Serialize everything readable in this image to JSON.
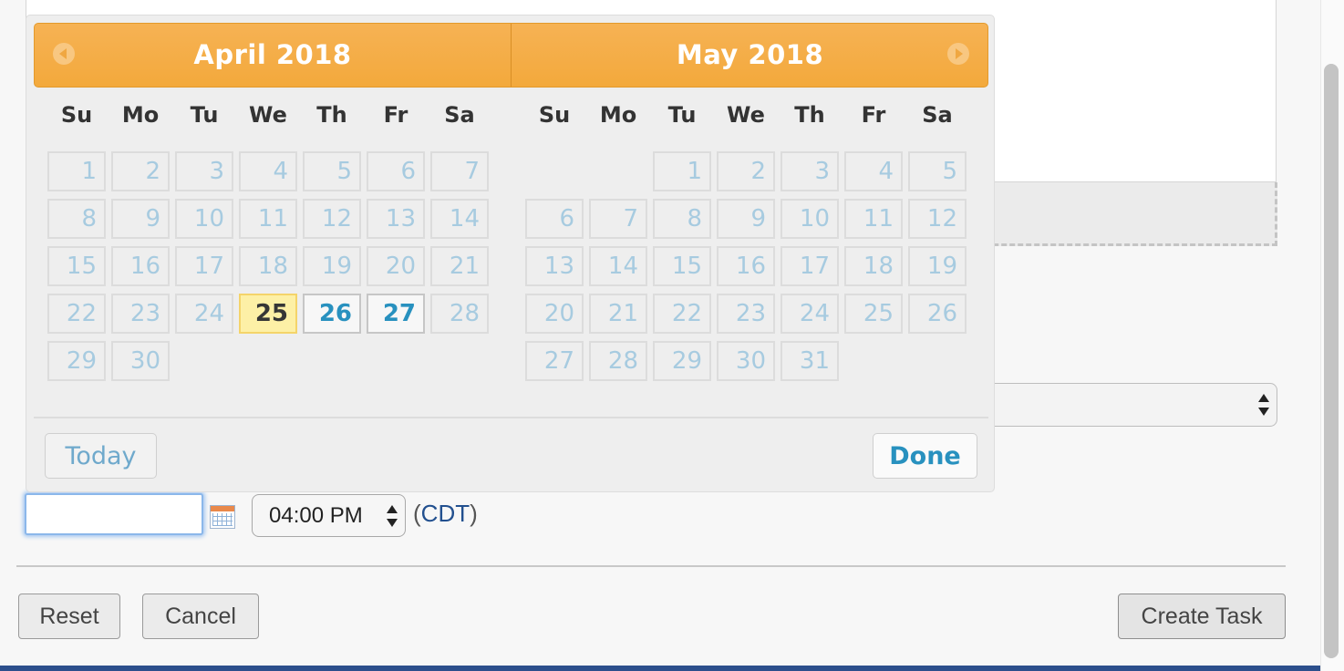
{
  "datepicker": {
    "months": [
      {
        "title": "April 2018",
        "weekdays": [
          "Su",
          "Mo",
          "Tu",
          "We",
          "Th",
          "Fr",
          "Sa"
        ],
        "weeks": [
          [
            "1",
            "2",
            "3",
            "4",
            "5",
            "6",
            "7"
          ],
          [
            "8",
            "9",
            "10",
            "11",
            "12",
            "13",
            "14"
          ],
          [
            "15",
            "16",
            "17",
            "18",
            "19",
            "20",
            "21"
          ],
          [
            "22",
            "23",
            "24",
            "25",
            "26",
            "27",
            "28"
          ],
          [
            "29",
            "30",
            "",
            "",
            "",
            "",
            ""
          ]
        ],
        "today": "25",
        "selectable": [
          "26",
          "27"
        ]
      },
      {
        "title": "May 2018",
        "weekdays": [
          "Su",
          "Mo",
          "Tu",
          "We",
          "Th",
          "Fr",
          "Sa"
        ],
        "weeks": [
          [
            "",
            "",
            "1",
            "2",
            "3",
            "4",
            "5"
          ],
          [
            "6",
            "7",
            "8",
            "9",
            "10",
            "11",
            "12"
          ],
          [
            "13",
            "14",
            "15",
            "16",
            "17",
            "18",
            "19"
          ],
          [
            "20",
            "21",
            "22",
            "23",
            "24",
            "25",
            "26"
          ],
          [
            "27",
            "28",
            "29",
            "30",
            "31",
            "",
            ""
          ]
        ],
        "today": "",
        "selectable": []
      }
    ],
    "today_label": "Today",
    "done_label": "Done",
    "prev_icon": "chevron-left-icon",
    "next_icon": "chevron-right-icon"
  },
  "form": {
    "date_value": "",
    "time_value": "04:00 PM",
    "timezone_open": "(",
    "timezone": "CDT",
    "timezone_close": ")",
    "reset_label": "Reset",
    "cancel_label": "Cancel",
    "create_label": "Create Task",
    "calendar_icon": "calendar-icon"
  },
  "colors": {
    "header_orange": "#f3a93c",
    "today_highlight": "#fdf0a6",
    "active_day_blue": "#2891bf",
    "link_blue": "#22508f"
  }
}
